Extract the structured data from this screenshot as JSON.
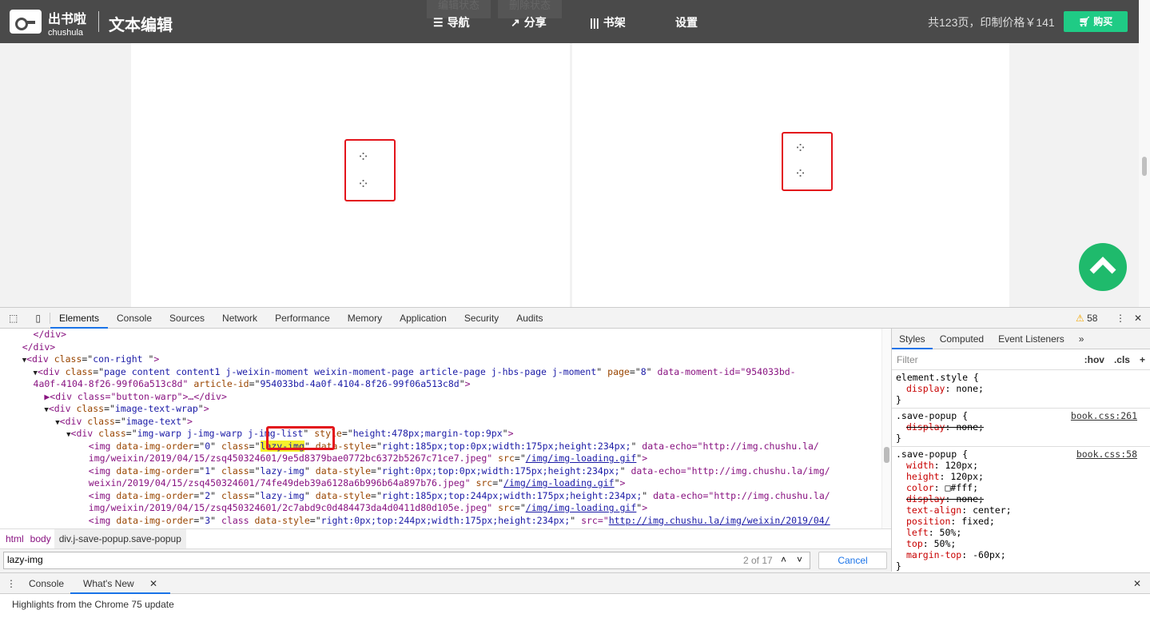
{
  "topbar": {
    "brand": "出书啦",
    "brand_sub": "chushula",
    "title": "文本编辑",
    "ghost_buttons": [
      "编辑状态",
      "删除状态"
    ],
    "nav": [
      {
        "icon": "list-icon",
        "label": "导航"
      },
      {
        "icon": "share-icon",
        "label": "分享"
      },
      {
        "icon": "bookshelf-icon",
        "label": "书架"
      },
      {
        "icon": "",
        "label": "设置"
      }
    ],
    "price_info": "共123页，印制价格￥141",
    "buy_label": "购买"
  },
  "colors": {
    "accent": "#1fcb85",
    "highlight": "#e3141b",
    "up_button": "#1fba6c"
  },
  "devtools": {
    "tabs": [
      "Elements",
      "Console",
      "Sources",
      "Network",
      "Performance",
      "Memory",
      "Application",
      "Security",
      "Audits"
    ],
    "warnings": "58",
    "styles_tabs": [
      "Styles",
      "Computed",
      "Event Listeners"
    ],
    "filter_placeholder": "Filter",
    "hov": ":hov",
    "cls": ".cls",
    "breadcrumb": [
      "html",
      "body",
      "div.j-save-popup.save-popup"
    ],
    "search": {
      "value": "lazy-img",
      "count": "2 of 17",
      "cancel": "Cancel"
    },
    "drawer_tabs": [
      "Console",
      "What's New"
    ],
    "drawer_text": "Highlights from the Chrome 75 update",
    "rules": [
      {
        "selector": "element.style {",
        "source": "",
        "props": [
          {
            "name": "display",
            "value": "none;",
            "struck": false
          }
        ]
      },
      {
        "selector": ".save-popup {",
        "source": "book.css:261",
        "props": [
          {
            "name": "display",
            "value": "none;",
            "struck": true
          }
        ]
      },
      {
        "selector": ".save-popup {",
        "source": "book.css:58",
        "props": [
          {
            "name": "width",
            "value": "120px;",
            "struck": false
          },
          {
            "name": "height",
            "value": "120px;",
            "struck": false
          },
          {
            "name": "color",
            "value": "□#fff;",
            "struck": false
          },
          {
            "name": "display",
            "value": "none;",
            "struck": true
          },
          {
            "name": "text-align",
            "value": "center;",
            "struck": false
          },
          {
            "name": "position",
            "value": "fixed;",
            "struck": false
          },
          {
            "name": "left",
            "value": "50%;",
            "struck": false
          },
          {
            "name": "top",
            "value": "50%;",
            "struck": false
          },
          {
            "name": "margin-top",
            "value": "-60px;",
            "struck": false
          }
        ]
      }
    ],
    "dom_lines": [
      "      </div>",
      "    </div>",
      "    ▼<div class=\"con-right \">",
      "      ▼<div class=\"page content content1 j-weixin-moment weixin-moment-page article-page j-hbs-page j-moment\" page=\"8\" data-moment-id=\"954033bd-",
      "      4a0f-4104-8f26-99f06a513c8d\" article-id=\"954033bd-4a0f-4104-8f26-99f06a513c8d\">",
      "        ▶<div class=\"button-warp\">…</div>",
      "        ▼<div class=\"image-text-wrap\">",
      "          ▼<div class=\"image-text\">",
      "            ▼<div class=\"img-warp j-img-warp j-img-list\" style=\"height:478px;margin-top:9px\">",
      "                <img data-img-order=\"0\" class=\"lazy-img\" data-style=\"right:185px;top:0px;width:175px;height:234px;\" data-echo=\"http://img.chushu.la/",
      "                img/weixin/2019/04/15/zsq450324601/9e5d8379bae0772bc6372b5267c71ce7.jpeg\" src=\"/img/img-loading.gif\">",
      "                <img data-img-order=\"1\" class=\"lazy-img\" data-style=\"right:0px;top:0px;width:175px;height:234px;\" data-echo=\"http://img.chushu.la/img/",
      "                weixin/2019/04/15/zsq450324601/74fe49deb39a6128a6b996b64a897b76.jpeg\" src=\"/img/img-loading.gif\">",
      "                <img data-img-order=\"2\" class=\"lazy-img\" data-style=\"right:185px;top:244px;width:175px;height:234px;\" data-echo=\"http://img.chushu.la/",
      "                img/weixin/2019/04/15/zsq450324601/2c7abd9c0d484473da4d0411d80d105e.jpeg\" src=\"/img/img-loading.gif\">",
      "                <img data-img-order=\"3\" class data-style=\"right:0px;top:244px;width:175px;height:234px;\" src=\"http://img.chushu.la/img/weixin/2019/04/"
    ]
  }
}
